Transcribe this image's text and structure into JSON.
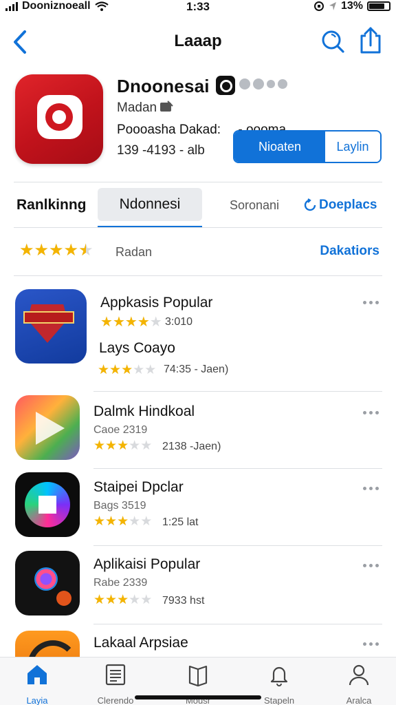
{
  "status_bar": {
    "carrier": "Dooniznoeall",
    "time": "1:33",
    "battery_percent": "13%"
  },
  "nav": {
    "title": "Laaap",
    "icons": [
      "chevron-left-icon",
      "search-icon",
      "share-icon"
    ]
  },
  "app": {
    "name": "Dnoonesai",
    "developer": "Madan",
    "category": "Poooasha Dakad:",
    "category_tail": "- oooma",
    "meta": "139 -4193 - alb",
    "primary_button": "Nioaten",
    "secondary_button": "Laylin"
  },
  "tabs": {
    "ranking": "Ranlkinng",
    "active": "Ndonnesi",
    "third": "Soronani",
    "fourth": "Doeplacs"
  },
  "rating": {
    "stars": 4.5,
    "label": "Radan",
    "link": "Dakatiors"
  },
  "list": [
    {
      "title": "Appkasis Popular",
      "rating": 4.0,
      "rating_text": "3:010",
      "subtitle": "Lays Coayo",
      "rating2": 3.0,
      "meta": "74:35 - Jaen)",
      "icon": "shield-badge-icon"
    },
    {
      "title": "Dalmk Hindkoal",
      "subtitle": "Caoe 2319",
      "rating": 3.0,
      "meta": "2138 -Jaen)",
      "icon": "play-icon"
    },
    {
      "title": "Staipei Dpclar",
      "subtitle": "Bags 3519",
      "rating": 3.0,
      "meta": "1:25 lat",
      "icon": "chat-bubble-icon"
    },
    {
      "title": "Aplikaisi Popular",
      "subtitle": "Rabe 2339",
      "rating": 3.0,
      "meta": "7933 hst",
      "icon": "vo-app-icon"
    },
    {
      "title": "Lakaal Arpsiae",
      "icon": "lakaal-app-icon"
    }
  ],
  "bottom_tabs": [
    {
      "label": "Layia",
      "icon": "home-icon"
    },
    {
      "label": "Clerendo",
      "icon": "calendar-icon"
    },
    {
      "label": "Mousr",
      "icon": "book-icon"
    },
    {
      "label": "Stapeln",
      "icon": "bell-icon"
    },
    {
      "label": "Aralca",
      "icon": "person-icon"
    }
  ],
  "colors": {
    "accent": "#1172d8",
    "star": "#f4b400",
    "app_icon": "#d21a22"
  }
}
